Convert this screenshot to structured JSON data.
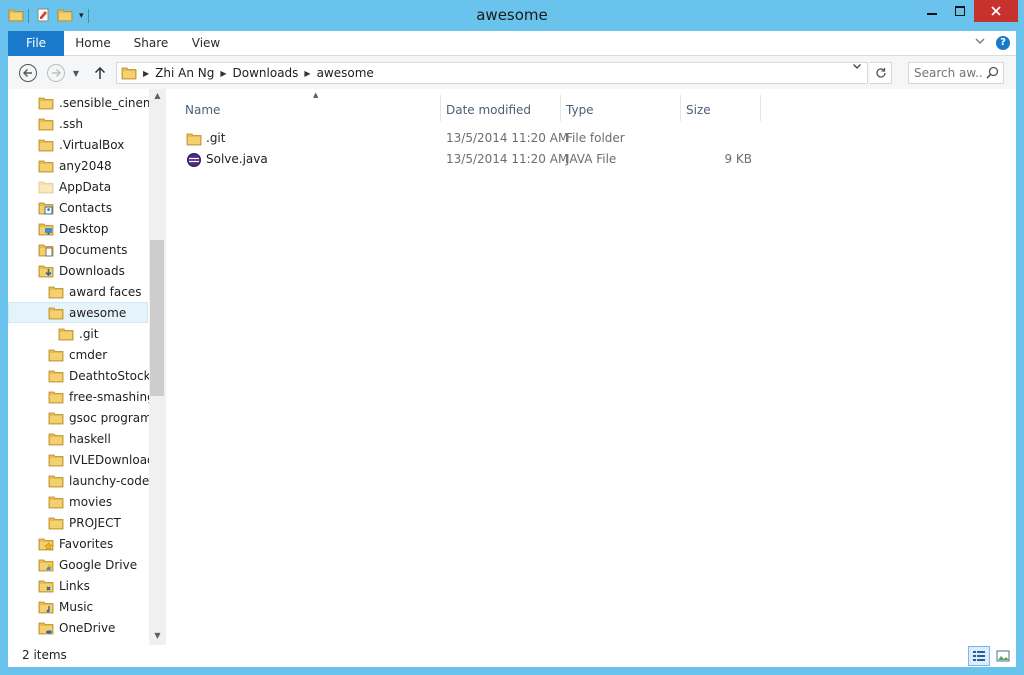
{
  "window": {
    "title": "awesome"
  },
  "colors": {
    "frame": "#6ac3ec",
    "file_tab": "#1979ca",
    "close": "#c7312e",
    "folder": "#e8bb4b"
  },
  "ribbon": {
    "tabs": [
      {
        "label": "File",
        "active": true
      },
      {
        "label": "Home"
      },
      {
        "label": "Share"
      },
      {
        "label": "View"
      }
    ],
    "help": "?"
  },
  "address": {
    "breadcrumbs": [
      "Zhi An Ng",
      "Downloads",
      "awesome"
    ]
  },
  "search": {
    "placeholder": "Search aw..."
  },
  "nav_tree": [
    {
      "label": ".sensible_cinema",
      "icon": "folder-icon"
    },
    {
      "label": ".ssh",
      "icon": "folder-icon"
    },
    {
      "label": ".VirtualBox",
      "icon": "folder-icon"
    },
    {
      "label": "any2048",
      "icon": "folder-icon"
    },
    {
      "label": "AppData",
      "icon": "folder-hidden-icon"
    },
    {
      "label": "Contacts",
      "icon": "contacts-folder-icon"
    },
    {
      "label": "Desktop",
      "icon": "desktop-folder-icon"
    },
    {
      "label": "Documents",
      "icon": "documents-folder-icon"
    },
    {
      "label": "Downloads",
      "icon": "downloads-folder-icon"
    },
    {
      "label": "award faces",
      "icon": "folder-icon"
    },
    {
      "label": "awesome",
      "icon": "folder-icon",
      "selected": true
    },
    {
      "label": ".git",
      "icon": "folder-icon"
    },
    {
      "label": "cmder",
      "icon": "folder-icon"
    },
    {
      "label": "DeathtoStock",
      "icon": "folder-icon"
    },
    {
      "label": "free-smashing-",
      "icon": "folder-icon"
    },
    {
      "label": "gsoc programs",
      "icon": "folder-icon"
    },
    {
      "label": "haskell",
      "icon": "folder-icon"
    },
    {
      "label": "IVLEDownloade",
      "icon": "folder-icon"
    },
    {
      "label": "launchy-code",
      "icon": "folder-icon"
    },
    {
      "label": "movies",
      "icon": "folder-icon"
    },
    {
      "label": "PROJECT",
      "icon": "folder-icon"
    },
    {
      "label": "Favorites",
      "icon": "favorites-folder-icon"
    },
    {
      "label": "Google Drive",
      "icon": "google-drive-folder-icon"
    },
    {
      "label": "Links",
      "icon": "links-folder-icon"
    },
    {
      "label": "Music",
      "icon": "music-folder-icon"
    },
    {
      "label": "OneDrive",
      "icon": "onedrive-folder-icon"
    }
  ],
  "columns": {
    "name": "Name",
    "date": "Date modified",
    "type": "Type",
    "size": "Size"
  },
  "files": [
    {
      "name": ".git",
      "date": "13/5/2014 11:20 AM",
      "type": "File folder",
      "size": "",
      "icon": "folder-icon"
    },
    {
      "name": "Solve.java",
      "date": "13/5/2014 11:20 AM",
      "type": "JAVA File",
      "size": "9 KB",
      "icon": "java-file-icon"
    }
  ],
  "status": {
    "item_count": "2 items"
  }
}
